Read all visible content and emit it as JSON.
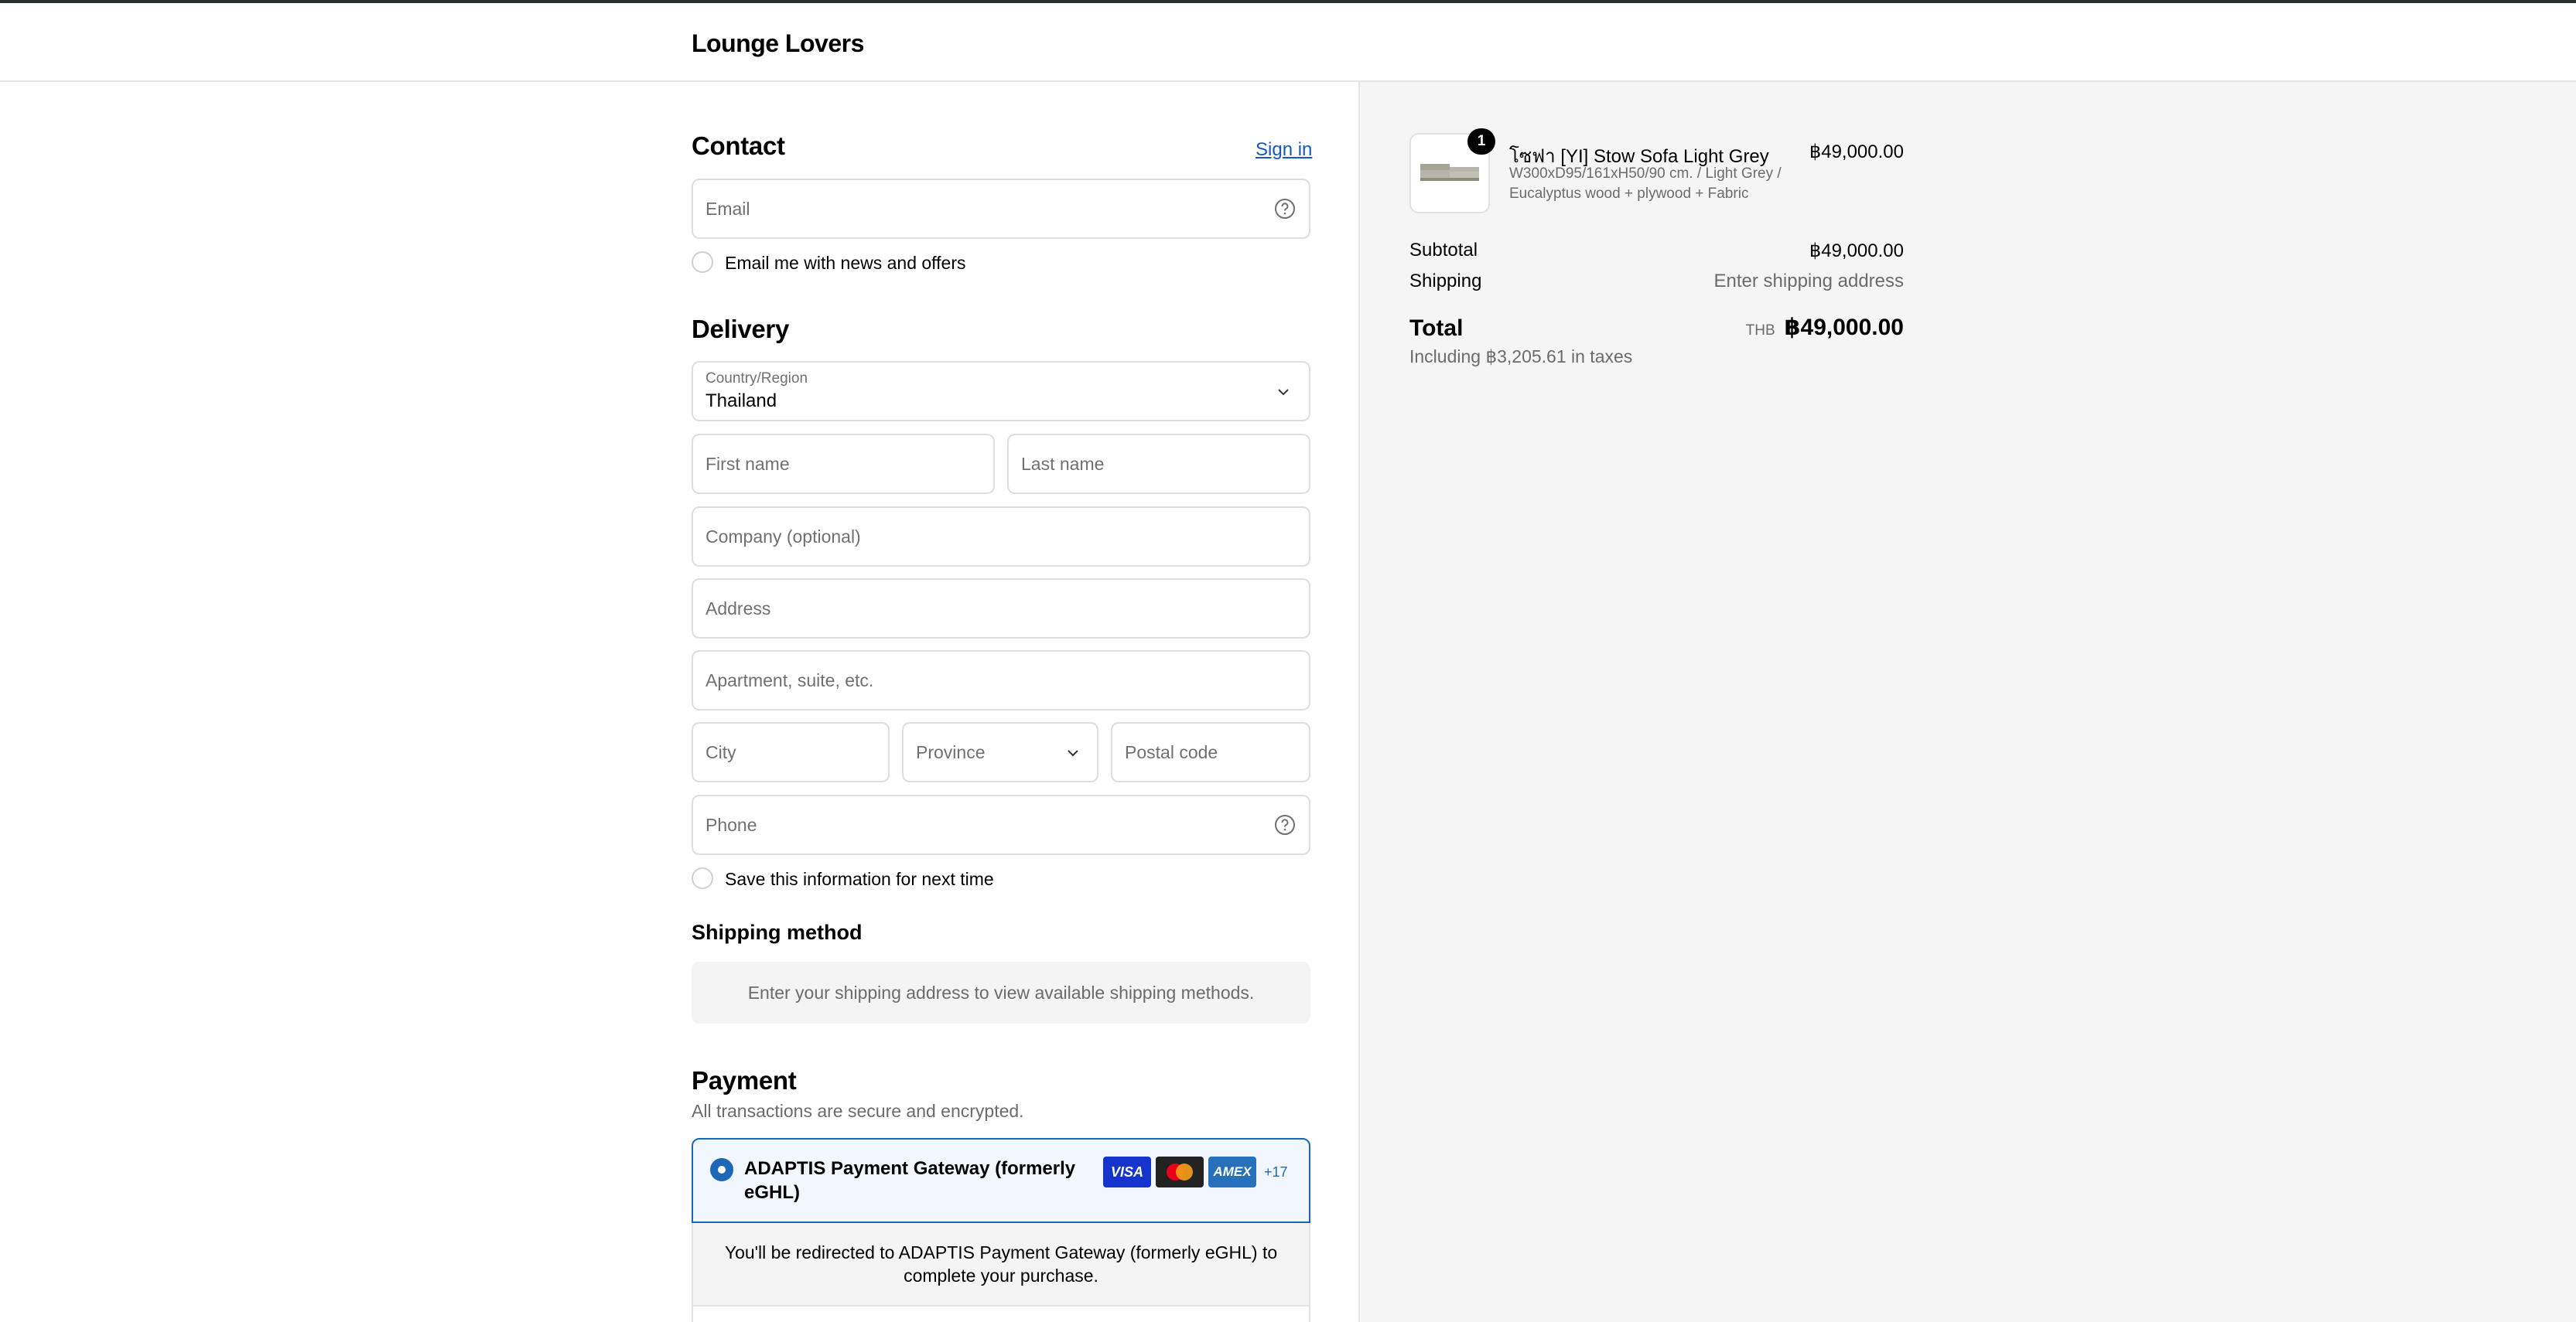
{
  "store": {
    "name": "Lounge Lovers"
  },
  "contact": {
    "heading": "Contact",
    "sign_in": "Sign in",
    "email_placeholder": "Email",
    "news_label": "Email me with news and offers"
  },
  "delivery": {
    "heading": "Delivery",
    "country_label": "Country/Region",
    "country_value": "Thailand",
    "first_name": "First name",
    "last_name": "Last name",
    "company": "Company (optional)",
    "address": "Address",
    "apartment": "Apartment, suite, etc.",
    "city": "City",
    "province": "Province",
    "postal": "Postal code",
    "phone": "Phone",
    "save_label": "Save this information for next time"
  },
  "shipping_method": {
    "heading": "Shipping method",
    "message": "Enter your shipping address to view available shipping methods."
  },
  "payment": {
    "heading": "Payment",
    "subtitle": "All transactions are secure and encrypted.",
    "option_name": "ADAPTIS Payment Gateway (formerly eGHL)",
    "cards": [
      "VISA",
      "mastercard",
      "AMEX"
    ],
    "more_cards": "+17",
    "redirect_message": "You'll be redirected to ADAPTIS Payment Gateway (formerly eGHL) to complete your purchase."
  },
  "summary": {
    "product_name": "โซฟา [YI] Stow Sofa Light Grey",
    "product_variant": "W300xD95/161xH50/90 cm. / Light Grey / Eucalyptus wood + plywood + Fabric",
    "quantity": "1",
    "product_price": "฿49,000.00",
    "subtotal_label": "Subtotal",
    "subtotal_value": "฿49,000.00",
    "shipping_label": "Shipping",
    "shipping_value": "Enter shipping address",
    "total_label": "Total",
    "currency": "THB",
    "total_value": "฿49,000.00",
    "taxes_note": "Including ฿3,205.61 in taxes"
  },
  "colors": {
    "accent": "#1d67b7",
    "link": "#1658bf",
    "visa": "#1434cb",
    "amex": "#2671b9"
  }
}
